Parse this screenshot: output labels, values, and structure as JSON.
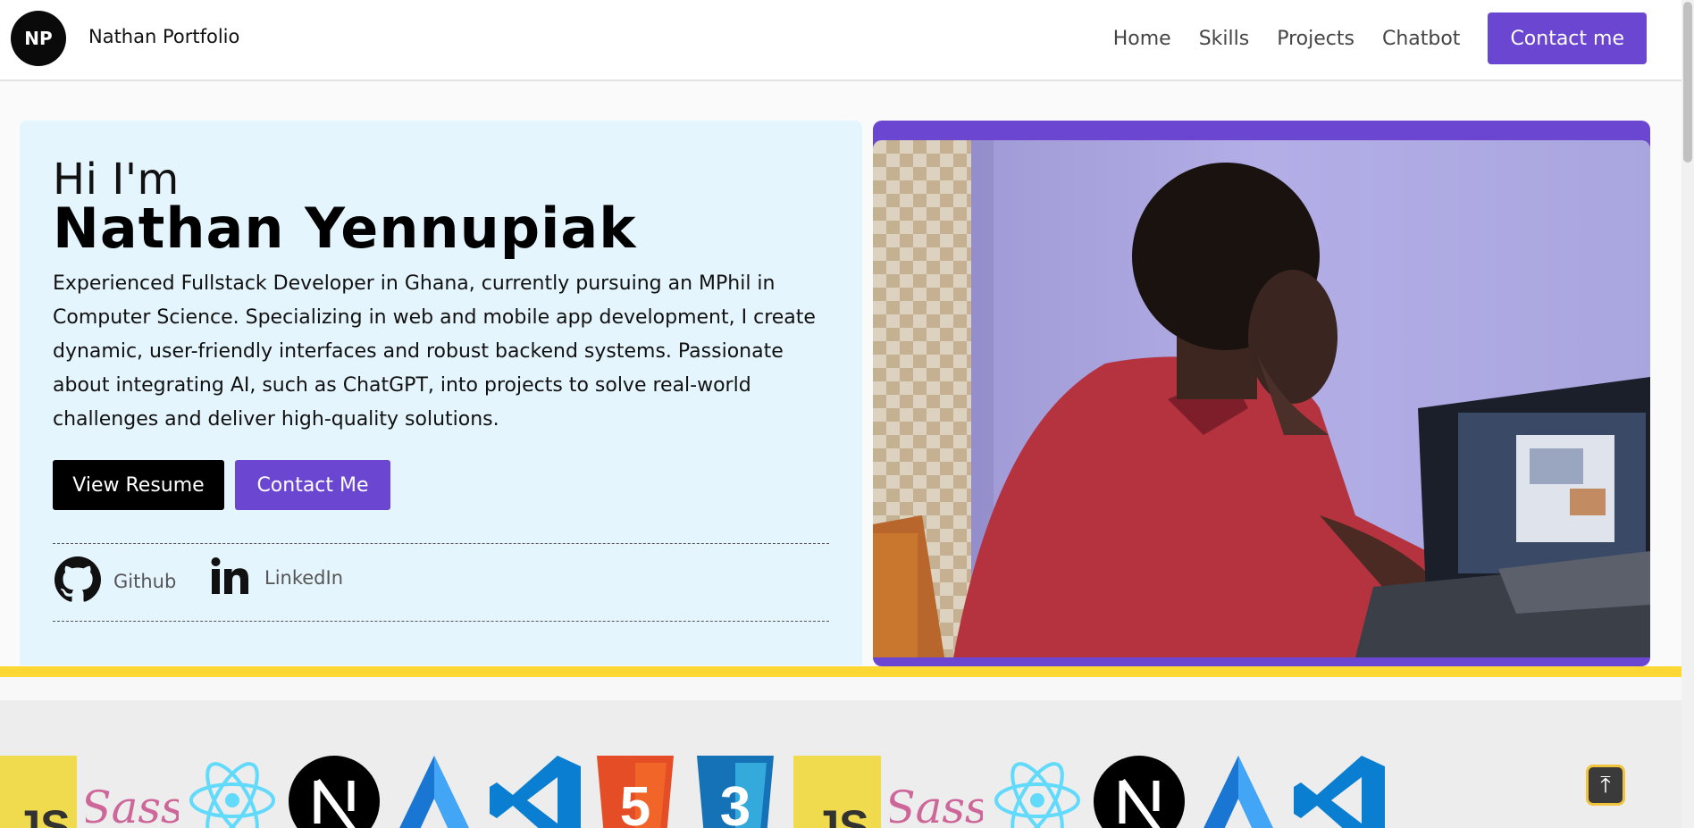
{
  "nav": {
    "logo_text": "NP",
    "brand": "Nathan Portfolio",
    "links": [
      "Home",
      "Skills",
      "Projects",
      "Chatbot"
    ],
    "cta": "Contact me"
  },
  "hero": {
    "greeting": "Hi I'm",
    "name": "Nathan Yennupiak",
    "description": "Experienced Fullstack Developer in Ghana, currently pursuing an MPhil in Computer Science. Specializing in web and mobile app development, I create dynamic, user-friendly interfaces and robust backend systems. Passionate about integrating AI, such as ChatGPT, into projects to solve real-world challenges and deliver high-quality solutions.",
    "resume_button": "View Resume",
    "contact_button": "Contact Me",
    "socials": [
      {
        "label": "Github",
        "icon": "github-icon"
      },
      {
        "label": "LinkedIn",
        "icon": "linkedin-icon"
      }
    ]
  },
  "skills": [
    "JS",
    "Sass",
    "React",
    "Next",
    "Angular",
    "VS Code",
    "5",
    "3",
    "JS",
    "Sass",
    "React",
    "Next",
    "Angular",
    "VS Code"
  ],
  "colors": {
    "accent": "#6b46d0",
    "hero_bg": "#e5f5fd",
    "yellow": "#fdd835"
  },
  "scroll_top_icon": "arrow-up-icon"
}
